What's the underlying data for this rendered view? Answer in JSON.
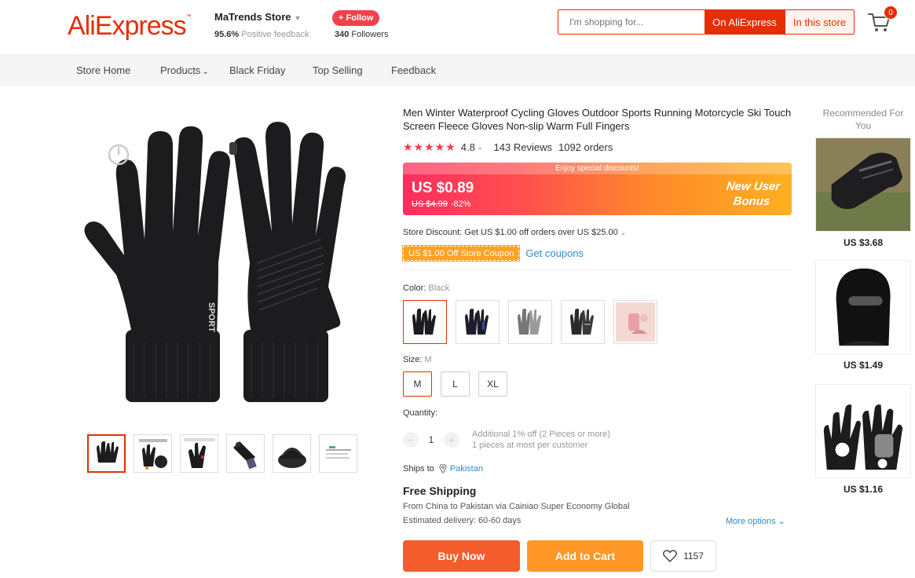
{
  "header": {
    "logo": "AliExpress",
    "logo_tm": "™",
    "store_name": "MaTrends Store",
    "feedback_pct": "95.6%",
    "feedback_label": "Positive feedback",
    "follow_label": "+ Follow",
    "followers_count": "340",
    "followers_label": "Followers",
    "search_placeholder": "I'm shopping for...",
    "btn_on_aliexpress": "On AliExpress",
    "btn_in_store": "In this store",
    "cart_count": "0"
  },
  "nav": {
    "items": [
      "Store Home",
      "Products",
      "Black Friday",
      "Top Selling",
      "Feedback"
    ]
  },
  "product": {
    "title": "Men Winter Waterproof Cycling Gloves Outdoor Sports Running Motorcycle Ski Touch Screen Fleece Gloves Non-slip Warm Full Fingers",
    "rating": "4.8",
    "reviews": "143 Reviews",
    "orders": "1092 orders",
    "banner_top": "Enjoy special discounts!",
    "price": "US $0.89",
    "old_price": "US $4.99",
    "discount": "-82%",
    "bonus_line1": "New User",
    "bonus_line2": "Bonus",
    "store_discount": "Store Discount: Get US $1.00 off orders over US $25.00",
    "coupon": "US $1.00 Off Store Coupon",
    "get_coupons": "Get coupons",
    "color_label": "Color:",
    "color_value": "Black",
    "size_label": "Size:",
    "size_value": "M",
    "sizes": [
      "M",
      "L",
      "XL"
    ],
    "quantity_label": "Quantity:",
    "quantity": "1",
    "qty_minus": "−",
    "qty_plus": "+",
    "qty_note1": "Additional 1% off (2 Pieces or more)",
    "qty_note2": "1 pieces at most per customer",
    "ships_to_label": "Ships to",
    "ships_to_country": "Pakistan",
    "free_shipping": "Free Shipping",
    "ship_desc": "From China to Pakistan via Cainiao Super Economy Global",
    "ship_eta": "Estimated delivery: 60-60 days",
    "more_options": "More options",
    "buy_now": "Buy Now",
    "add_to_cart": "Add to Cart",
    "wishlist_count": "1157"
  },
  "recommended": {
    "title": "Recommended For You",
    "items": [
      {
        "price": "US $3.68"
      },
      {
        "price": "US $1.49"
      },
      {
        "price": "US $1.16"
      }
    ]
  },
  "colors": {
    "brand": "#e62e04",
    "accent_red": "#f5374a",
    "buy_now": "#f55c2b",
    "add_to_cart": "#ff9727",
    "link": "#2e8bc9"
  }
}
